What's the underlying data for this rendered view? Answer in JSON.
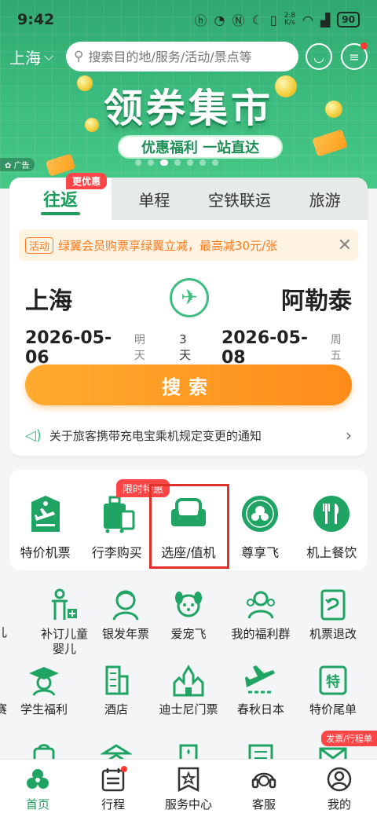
{
  "status": {
    "time": "9:42",
    "speed": "2.8\nK/s",
    "battery": "90"
  },
  "header": {
    "city": "上海",
    "search_placeholder": "搜索目的地/服务/活动/景点等"
  },
  "banner": {
    "title": "领券集市",
    "subtitle": "优惠福利 一站直达",
    "ad_label": "广告"
  },
  "tabs": {
    "active": "往返",
    "active_badge": "更优惠",
    "others": [
      "单程",
      "空铁联运",
      "旅游"
    ]
  },
  "promo": {
    "tag": "活动",
    "text": "绿翼会员购票享绿翼立减，最高减30元/张"
  },
  "route": {
    "from": "上海",
    "to": "阿勒泰"
  },
  "dates": {
    "depart": "2026-05-06",
    "depart_day": "明天",
    "duration": "3天",
    "return": "2026-05-08",
    "return_day": "周五"
  },
  "search_button": "搜索",
  "notice": "关于旅客携带充电宝乘机规定变更的通知",
  "quick": {
    "badge": "限时特惠",
    "items": [
      "特价机票",
      "行李购买",
      "选座/值机",
      "尊享飞",
      "机上餐饮"
    ]
  },
  "grid": {
    "row1": [
      "补订儿童婴儿",
      "银发年票",
      "爱宠飞",
      "我的福利群",
      "机票退改"
    ],
    "row2": [
      "学生福利",
      "酒店",
      "迪士尼门票",
      "春秋日本",
      "特价尾单"
    ],
    "edge_row1": "儿",
    "edge_row2": "赛",
    "corner_badge": "发票/行程单"
  },
  "nav": [
    "首页",
    "行程",
    "服务中心",
    "客服",
    "我的"
  ]
}
